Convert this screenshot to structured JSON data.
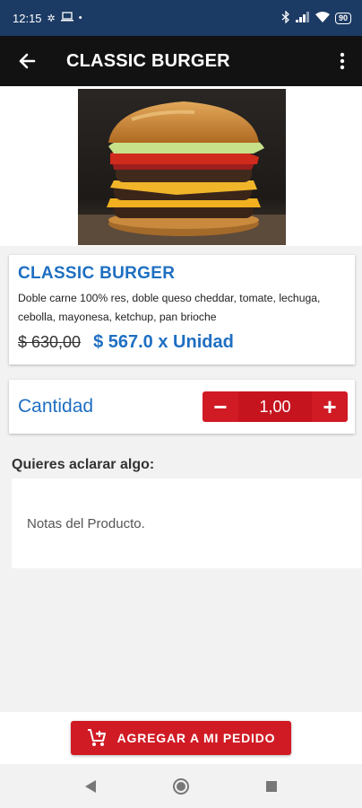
{
  "status_bar": {
    "time": "12:15",
    "battery": "90"
  },
  "app_bar": {
    "title": "CLASSIC BURGER"
  },
  "product": {
    "image_icon": "burger-photo",
    "name": "CLASSIC BURGER",
    "description": "Doble carne 100% res, doble queso cheddar, tomate, lechuga, cebolla, mayonesa, ketchup, pan brioche",
    "old_price": "$ 630,00",
    "new_price": "$ 567.0 x Unidad"
  },
  "quantity": {
    "label": "Cantidad",
    "minus": "−",
    "value": "1,00",
    "plus": "+"
  },
  "notes": {
    "label": "Quieres aclarar algo:",
    "placeholder": "Notas del Producto."
  },
  "actions": {
    "add_label": "AGREGAR A MI PEDIDO"
  },
  "colors": {
    "status_bar": "#1b3a64",
    "app_bar": "#121212",
    "accent_blue": "#1e6fc2",
    "accent_red": "#d01b25"
  }
}
